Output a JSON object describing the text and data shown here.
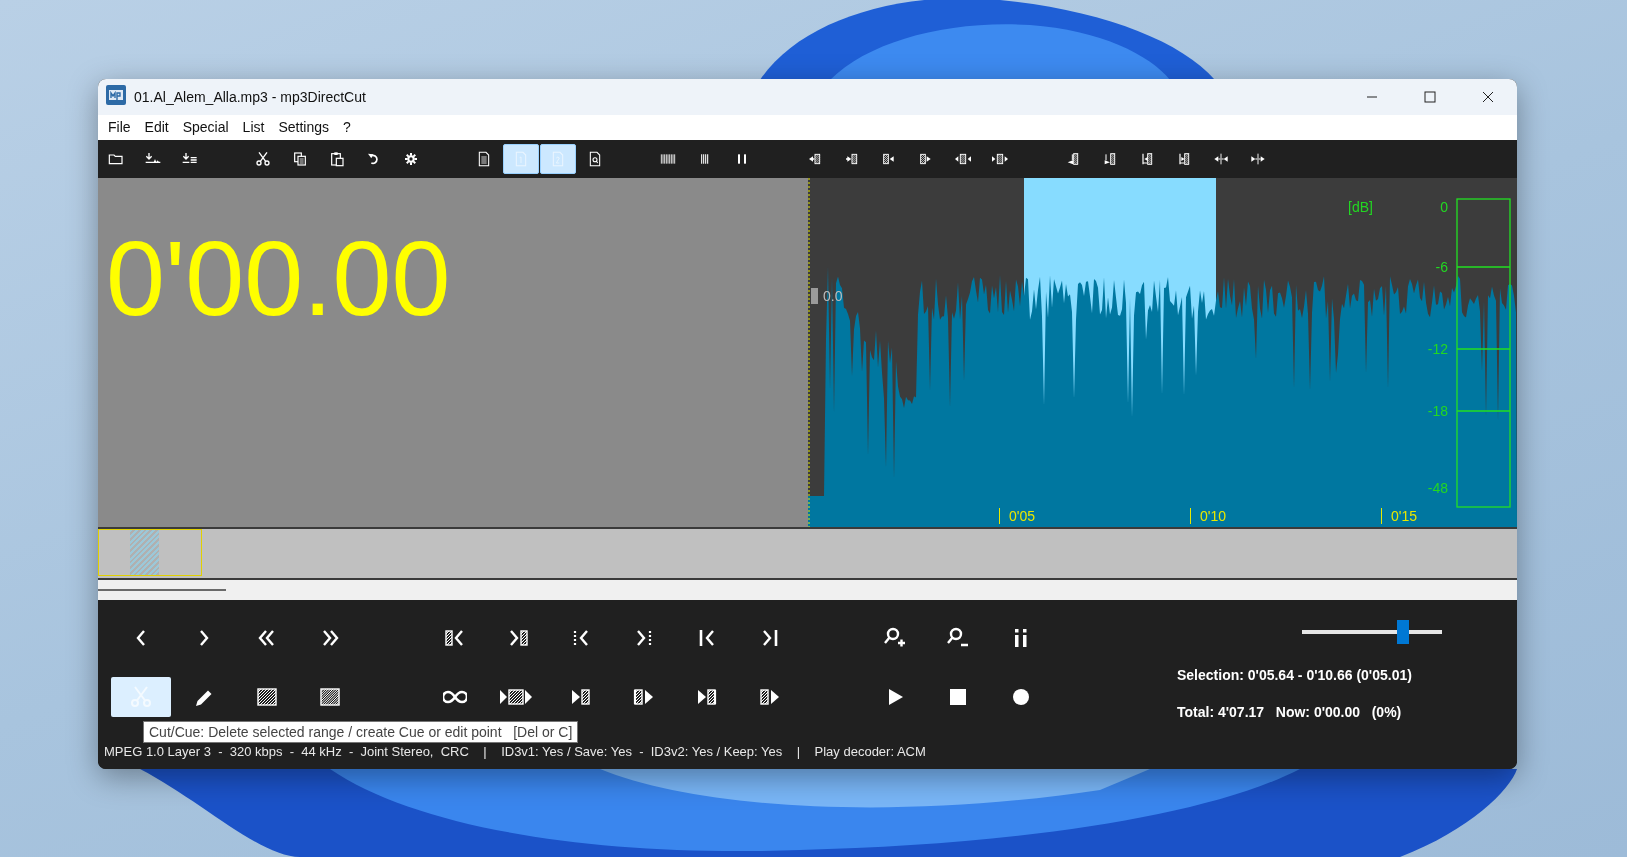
{
  "window": {
    "title": "01.Al_Alem_Alla.mp3 - mp3DirectCut"
  },
  "menu": [
    "File",
    "Edit",
    "Special",
    "List",
    "Settings",
    "?"
  ],
  "toolbar": [
    [
      {
        "kind": "open",
        "selected": false
      },
      {
        "kind": "export-wave",
        "selected": false
      },
      {
        "kind": "export-list",
        "selected": false
      }
    ],
    [
      {
        "kind": "cut",
        "selected": false
      },
      {
        "kind": "copy",
        "selected": false
      },
      {
        "kind": "paste",
        "selected": false
      },
      {
        "kind": "undo",
        "selected": false
      },
      {
        "kind": "settings",
        "selected": false
      }
    ],
    [
      {
        "kind": "page",
        "selected": false
      },
      {
        "kind": "page-a",
        "selected": true
      },
      {
        "kind": "page-b",
        "selected": true
      },
      {
        "kind": "page-find",
        "selected": false
      }
    ],
    [
      {
        "kind": "bars-wide",
        "selected": false
      },
      {
        "kind": "bars",
        "selected": false
      },
      {
        "kind": "pause",
        "selected": false
      }
    ],
    [
      {
        "kind": "in-left",
        "selected": false
      },
      {
        "kind": "in-right",
        "selected": false
      },
      {
        "kind": "hatch-left",
        "selected": false
      },
      {
        "kind": "hatch-right",
        "selected": false
      },
      {
        "kind": "out-left",
        "selected": false
      },
      {
        "kind": "out-right",
        "selected": false
      }
    ],
    [
      {
        "kind": "mark-down",
        "selected": false
      },
      {
        "kind": "mark-up",
        "selected": false
      },
      {
        "kind": "step-down",
        "selected": false
      },
      {
        "kind": "step-up",
        "selected": false
      },
      {
        "kind": "spread-in",
        "selected": false
      },
      {
        "kind": "spread-out",
        "selected": false
      }
    ]
  ],
  "timer": "0'00.00",
  "waveform": {
    "peak_label": "0.0",
    "time_labels": [
      "0'05",
      "0'10",
      "0'15"
    ],
    "db_unit": "[dB]",
    "db_scale": [
      "0",
      "-6",
      "-12",
      "-18",
      "-48"
    ]
  },
  "transport": [
    [
      [
        {
          "kind": "prev",
          "selected": false
        },
        {
          "kind": "next",
          "selected": false
        },
        {
          "kind": "rewind",
          "selected": false
        },
        {
          "kind": "forward",
          "selected": false
        }
      ],
      [
        {
          "kind": "sel-back",
          "selected": false
        },
        {
          "kind": "sel-fwd",
          "selected": false
        },
        {
          "kind": "cue-back",
          "selected": false
        },
        {
          "kind": "cue-fwd",
          "selected": false
        },
        {
          "kind": "start",
          "selected": false
        },
        {
          "kind": "end",
          "selected": false
        }
      ],
      [
        {
          "kind": "zoom-in",
          "selected": false
        },
        {
          "kind": "zoom-out",
          "selected": false
        },
        {
          "kind": "info",
          "selected": false
        }
      ]
    ],
    [
      [
        {
          "kind": "cut",
          "selected": true
        },
        {
          "kind": "pencil",
          "selected": false
        },
        {
          "kind": "hatch",
          "selected": false
        },
        {
          "kind": "hatch-dense",
          "selected": false
        }
      ],
      [
        {
          "kind": "loop",
          "selected": false
        },
        {
          "kind": "play-around",
          "selected": false
        },
        {
          "kind": "play-before",
          "selected": false
        },
        {
          "kind": "hatch-play",
          "selected": false
        },
        {
          "kind": "play-to",
          "selected": false
        },
        {
          "kind": "hatch-play-2",
          "selected": false
        }
      ],
      [
        {
          "kind": "play",
          "selected": false
        },
        {
          "kind": "stop",
          "selected": false
        },
        {
          "kind": "record",
          "selected": false
        }
      ]
    ]
  ],
  "tooltip": "Cut/Cue: Delete selected range / create Cue or edit point   [Del or C]",
  "zoom_slider": {
    "level": 0.72
  },
  "selection": "Selection: 0'05.64 - 0'10.66 (0'05.01)",
  "total": "Total: 4'07.17   Now: 0'00.00   (0%)",
  "status_bar": "MPEG 1.0 Layer 3  -  320 kbps  -  44 kHz  -  Joint Stereo,  CRC    |    ID3v1: Yes / Save: Yes  -  ID3v2: Yes / Keep: Yes    |    Play decoder: ACM"
}
